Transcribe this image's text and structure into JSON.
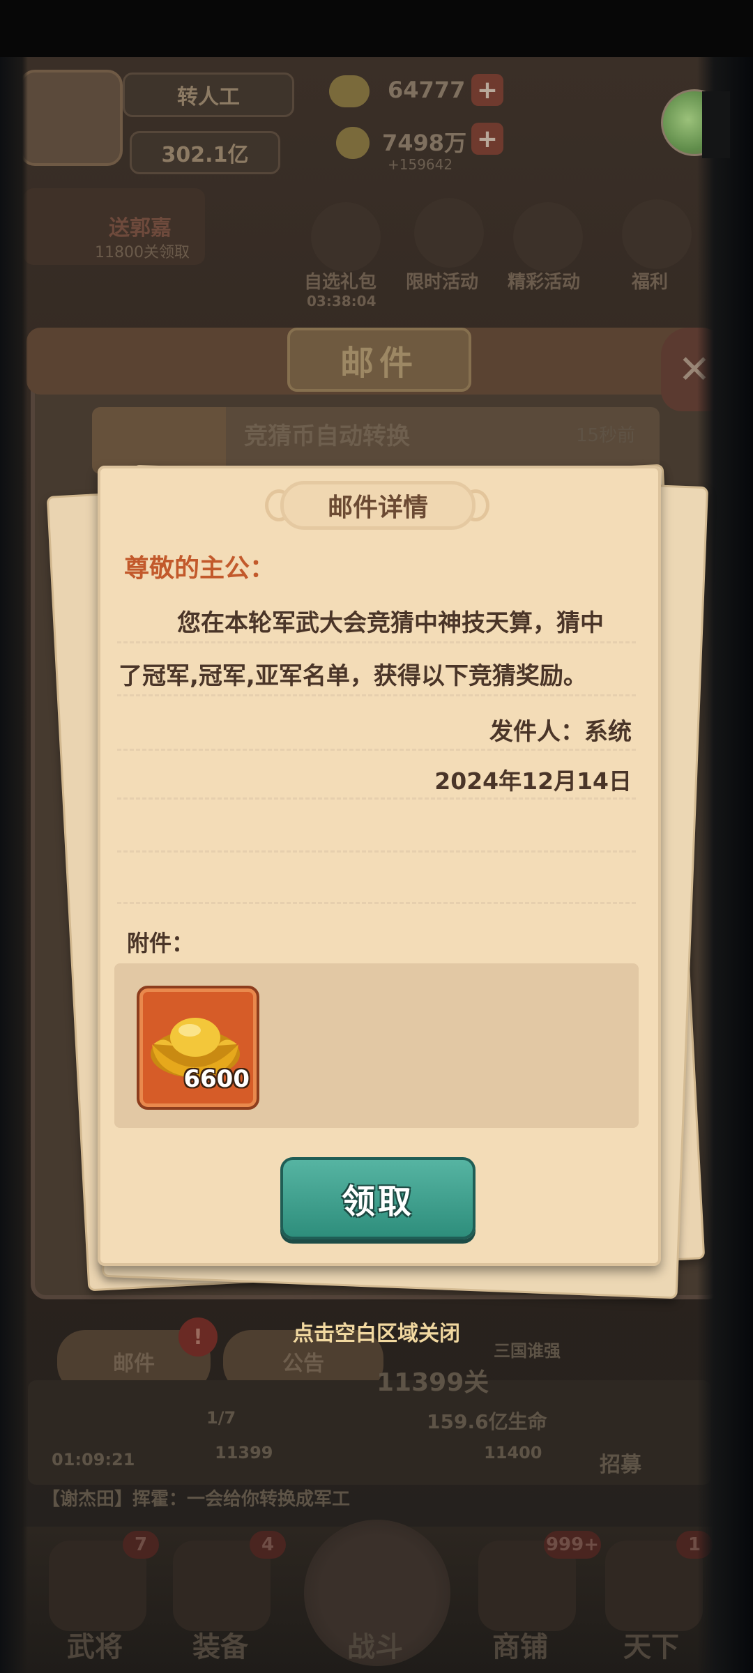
{
  "background": {
    "header": {
      "name_button": "转人工",
      "power": "302.1亿",
      "gold": "64777",
      "coins": "7498万",
      "coins_sub": "+159642"
    },
    "promo": {
      "title": "送郭嘉",
      "subtitle": "11800关领取"
    },
    "events": [
      {
        "label": "自选礼包",
        "timer": "03:38:04"
      },
      {
        "label": "限时活动"
      },
      {
        "label": "精彩活动"
      },
      {
        "label": "福利"
      }
    ],
    "mail_board": {
      "title": "邮件",
      "mail_item": {
        "title": "竞猜币自动转换",
        "time": "15秒前"
      },
      "tabs": [
        "邮件",
        "公告"
      ],
      "mail_badge": "!"
    },
    "info": {
      "stage": "11399关",
      "progress": "1/7",
      "hp": "159.6亿生命",
      "level_a": "11399",
      "level_b": "11400",
      "timer": "01:09:21",
      "recruit": "招募",
      "sanguo": "三国谁强",
      "ticker": "【谢杰田】挥霍：一会给你转换成军工"
    },
    "nav": [
      {
        "label": "武将",
        "badge": "7"
      },
      {
        "label": "装备",
        "badge": "4"
      },
      {
        "label": "战斗"
      },
      {
        "label": "商铺",
        "badge": "999+"
      },
      {
        "label": "天下",
        "badge": "1"
      }
    ]
  },
  "dialog": {
    "title": "邮件详情",
    "salutation": "尊敬的主公：",
    "body_line1": "您在本轮军武大会竞猜中神技天算，猜中",
    "body_line2": "了冠军,冠军,亚军名单，获得以下竞猜奖励。",
    "sender": "发件人：系统",
    "date": "2024年12月14日",
    "attachment_label": "附件：",
    "attachment_item": {
      "icon": "gold-ingot-icon",
      "quantity": "6600"
    },
    "claim_button": "领取",
    "close_hint": "点击空白区域关闭"
  },
  "colors": {
    "paper": "#f3dcb7",
    "salutation": "#c2592b",
    "claim_button": "#3fa08d",
    "item_tile": "#d65c28",
    "close_hint": "#f1d8a0"
  }
}
